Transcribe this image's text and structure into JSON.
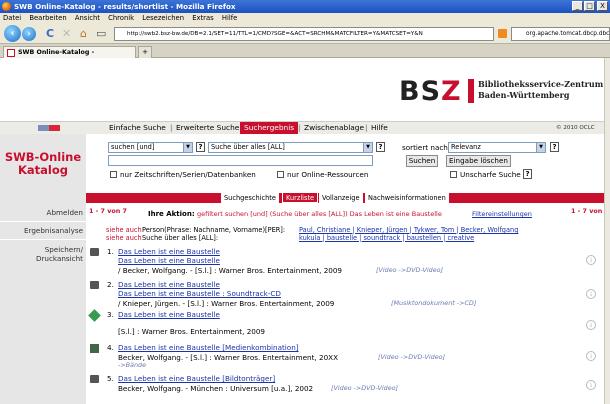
{
  "window": {
    "title": "SWB Online-Katalog - results/shortlist - Mozilla Firefox",
    "min": "_",
    "max": "□",
    "close": "X"
  },
  "menu": [
    "Datei",
    "Bearbeiten",
    "Ansicht",
    "Chronik",
    "Lesezeichen",
    "Extras",
    "Hilfe"
  ],
  "nav": {
    "url": "http://swb2.bsz-bw.de/DB=2.1/SET=11/TTL=1/CMD?SGE=&ACT=SRCHM&MATCFILTER=Y&MATCSET=Y&N",
    "search_value": "org.apache.tomcat.dbcp.dbc"
  },
  "tabs": [
    {
      "label": "SWB Online-Katalog - results/shortlist"
    },
    {
      "label": "+"
    }
  ],
  "logo": {
    "bsz": "BS",
    "z": "Z",
    "line1": "Bibliotheksservice-Zentrum",
    "line2": "Baden-Württemberg"
  },
  "topnav": {
    "items": [
      "Einfache Suche",
      "Erweiterte Suche",
      "Suchergebnis",
      "Zwischenablage",
      "Hilfe"
    ],
    "active": "Suchergebnis",
    "copyright": "© 2010 OCLC"
  },
  "brand": {
    "line1": "SWB-Online",
    "line2": "Katalog"
  },
  "search": {
    "operator": "suchen [und]",
    "field": "Suche über alles [ALL]",
    "sort_label": "sortiert nach",
    "sort_value": "Relevanz",
    "search_button": "Suchen",
    "clear_button": "Eingabe löschen",
    "chk1": "nur Zeitschriften/Serien/Datenbanken",
    "chk2": "nur Online-Ressourcen",
    "chk3": "Unscharfe Suche",
    "help": "?"
  },
  "subtabs": [
    "Suchgeschichte",
    "Kurzliste",
    "Vollanzeige",
    "Nachweisinformationen"
  ],
  "subtab_active": "Kurzliste",
  "sidebar": [
    "Abmelden",
    "Ergebnisanalyse",
    "Speichern/",
    "Druckansicht"
  ],
  "results": {
    "count": "1 - 7 von 7",
    "action_label": "Ihre Aktion:",
    "action_text": "gefiltert suchen [und] (Suche über alles [ALL]) Das Leben ist eine Baustelle",
    "filter_link": "Filtereinstellungen",
    "see_also_1_label": "siehe auch",
    "see_also_1_text": "Person(Phrase: Nachname, Vorname)[PER]:",
    "see_also_1_links": "Paul, Christiane | Knieper, Jürgen | Tykwer, Tom | Becker, Wolfgang",
    "see_also_2_label": "siehe auch",
    "see_also_2_text": "Suche über alles [ALL]:",
    "see_also_2_links": "kukula | baustelle | soundtrack | baustellen | creative",
    "items": [
      {
        "num": "1.",
        "title": "Das Leben ist eine Baustelle",
        "title2": "Das Leben ist eine Baustelle",
        "author": "/ Becker, Wolfgang. - [S.l.] : Warner Bros. Entertainment, 2009",
        "type": "[Video ->DVD-Video]"
      },
      {
        "num": "2.",
        "title": "Das Leben ist eine Baustelle",
        "title2": "Das Leben ist eine Baustelle : Soundtrack-CD",
        "author": "/ Knieper, Jürgen. - [S.l.] : Warner Bros. Entertainment, 2009",
        "type": "[Musiktondokument ->CD]"
      },
      {
        "num": "3.",
        "title": "Das Leben ist eine Baustelle",
        "title2": "",
        "author": "[S.l.] : Warner Bros. Entertainment, 2009",
        "type": ""
      },
      {
        "num": "4.",
        "title": "Das Leben ist eine Baustelle [Medienkombination]",
        "title2": "",
        "author": "Becker, Wolfgang. - [S.l.] : Warner Bros. Entertainment, 20XX",
        "type": "[Video ->DVD-Video]",
        "extra": "->Bände"
      },
      {
        "num": "5.",
        "title": "Das Leben ist eine Baustelle [Bildtonträger]",
        "title2": "",
        "author": "Becker, Wolfgang. - München : Universum [u.a.], 2002",
        "type": "[Video ->DVD-Video]"
      }
    ]
  }
}
